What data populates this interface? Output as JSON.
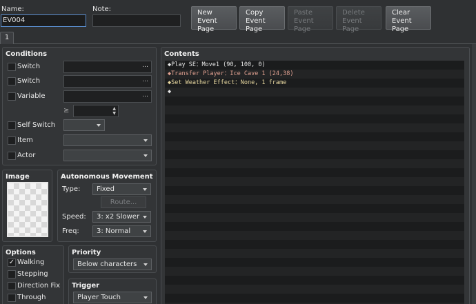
{
  "header": {
    "name_label": "Name:",
    "name_value": "EV004",
    "note_label": "Note:",
    "note_value": ""
  },
  "toolbar": {
    "new_page": "New\nEvent Page",
    "copy_page": "Copy\nEvent Page",
    "paste_page": "Paste\nEvent Page",
    "delete_page": "Delete\nEvent Page",
    "clear_page": "Clear\nEvent Page"
  },
  "tabs": [
    {
      "label": "1"
    }
  ],
  "conditions": {
    "title": "Conditions",
    "switch1": "Switch",
    "switch2": "Switch",
    "variable": "Variable",
    "gte": "≥",
    "self_switch": "Self Switch",
    "item": "Item",
    "actor": "Actor",
    "dots": "…"
  },
  "image": {
    "title": "Image"
  },
  "movement": {
    "title": "Autonomous Movement",
    "type_label": "Type:",
    "type_value": "Fixed",
    "route_label": "Route...",
    "speed_label": "Speed:",
    "speed_value": "3: x2 Slower",
    "freq_label": "Freq:",
    "freq_value": "3: Normal"
  },
  "options": {
    "title": "Options",
    "walking": "Walking",
    "stepping": "Stepping",
    "direction_fix": "Direction Fix",
    "through": "Through"
  },
  "priority": {
    "title": "Priority",
    "value": "Below characters"
  },
  "trigger": {
    "title": "Trigger",
    "value": "Player Touch"
  },
  "contents": {
    "title": "Contents",
    "commands": [
      {
        "text": "◆Play SE：Move1 (90, 100, 0)",
        "color": "#e6e6e6"
      },
      {
        "text": "◆Transfer Player：Ice Cave 1 (24,38)",
        "color": "#e0a090"
      },
      {
        "text": "◆Set Weather Effect：None, 1 frame",
        "color": "#e8d8a0"
      },
      {
        "text": "◆",
        "color": "#e6e6e6"
      }
    ]
  }
}
